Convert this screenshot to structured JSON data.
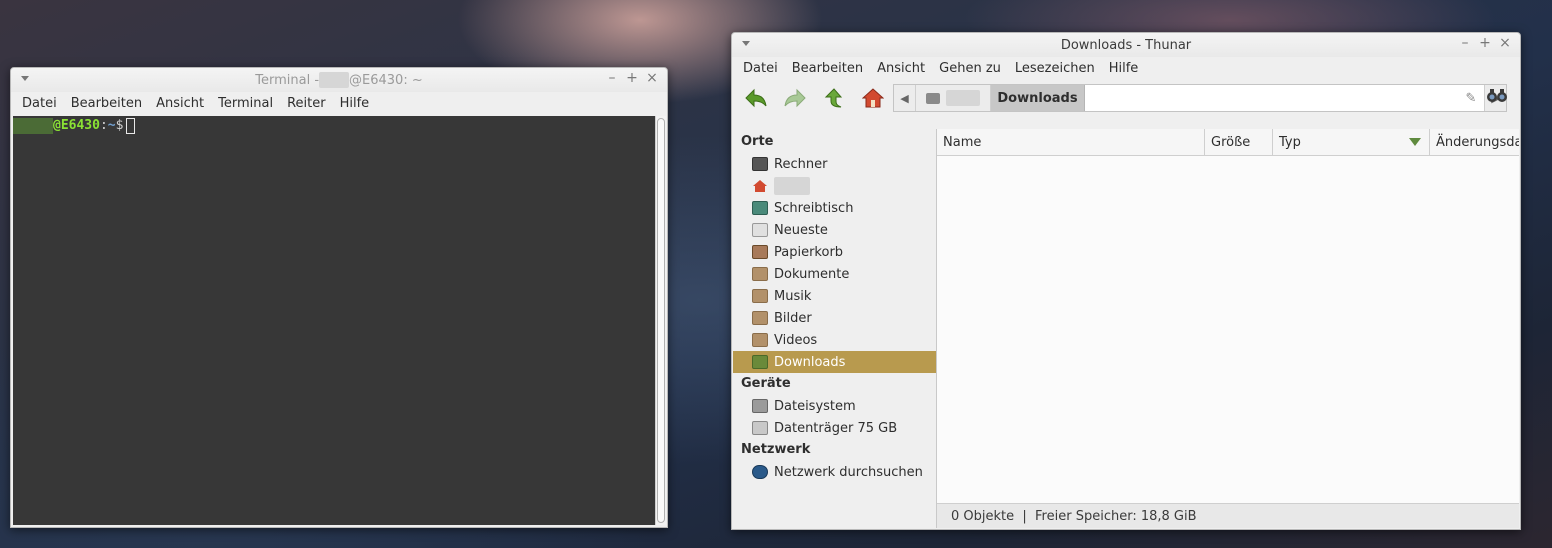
{
  "terminal": {
    "title_prefix": "Terminal - ",
    "title_suffix": "@E6430: ~",
    "menu": [
      "Datei",
      "Bearbeiten",
      "Ansicht",
      "Terminal",
      "Reiter",
      "Hilfe"
    ],
    "prompt_host": "@E6430",
    "prompt_sep": ":",
    "prompt_path": "~",
    "prompt_symbol": "$"
  },
  "thunar": {
    "title": "Downloads - Thunar",
    "menu": [
      "Datei",
      "Bearbeiten",
      "Ansicht",
      "Gehen zu",
      "Lesezeichen",
      "Hilfe"
    ],
    "toolbar": {
      "back_icon": "back-arrow-icon",
      "forward_icon": "forward-arrow-icon",
      "up_icon": "up-arrow-icon",
      "home_icon": "home-icon"
    },
    "pathbar": {
      "current": "Downloads"
    },
    "sidebar": {
      "places_title": "Orte",
      "places": [
        "Rechner",
        "",
        "Schreibtisch",
        "Neueste",
        "Papierkorb",
        "Dokumente",
        "Musik",
        "Bilder",
        "Videos",
        "Downloads"
      ],
      "devices_title": "Geräte",
      "devices": [
        "Dateisystem",
        "Datenträger 75 GB"
      ],
      "network_title": "Netzwerk",
      "network": [
        "Netzwerk durchsuchen"
      ]
    },
    "columns": [
      "Name",
      "Größe",
      "Typ",
      "Änderungsda"
    ],
    "status": "0 Objekte  |  Freier Speicher: 18,8 GiB",
    "colors": {
      "selection": "#b89a4e",
      "terminal_bg": "#373737",
      "prompt_green": "#8ae234",
      "prompt_blue": "#729fcf"
    }
  }
}
